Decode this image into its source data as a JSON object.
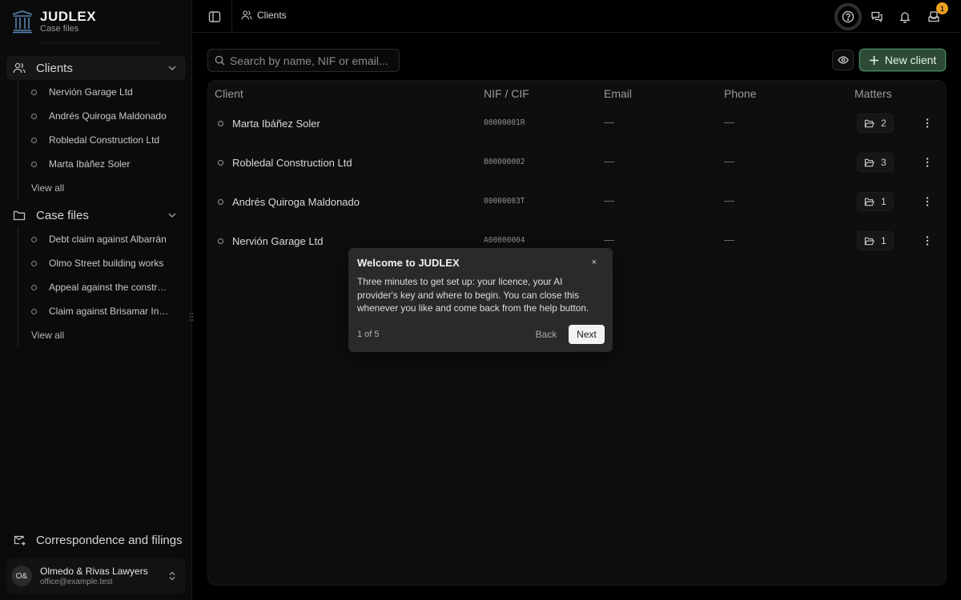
{
  "brand": {
    "name": "JUDLEX",
    "subtitle": "Case files",
    "logo_icon": "columns-logo-icon"
  },
  "sidebar": {
    "clients": {
      "label": "Clients",
      "items": [
        {
          "label": "Nervión Garage Ltd"
        },
        {
          "label": "Andrés Quiroga Maldonado"
        },
        {
          "label": "Robledal Construction Ltd"
        },
        {
          "label": "Marta Ibáñez Soler"
        }
      ],
      "view_all": "View all"
    },
    "case_files": {
      "label": "Case files",
      "items": [
        {
          "label": "Debt claim against Albarrán"
        },
        {
          "label": "Olmo Street building works"
        },
        {
          "label": "Appeal against the construction"
        },
        {
          "label": "Claim against Brisamar Insurance"
        }
      ],
      "view_all": "View all"
    },
    "correspondence": "Correspondence and filings",
    "account": {
      "initials": "O&",
      "name": "Olmedo & Rivas Lawyers",
      "email": "office@example.test"
    }
  },
  "topbar": {
    "breadcrumb": "Clients",
    "notification_count": "1"
  },
  "toolbar": {
    "search_placeholder": "Search by name, NIF or email...",
    "new_client_label": "New client"
  },
  "table": {
    "headers": {
      "client": "Client",
      "nif": "NIF / CIF",
      "email": "Email",
      "phone": "Phone",
      "matters": "Matters"
    },
    "rows": [
      {
        "name": "Marta Ibáñez Soler",
        "nif": "00000001R",
        "email": "—",
        "phone": "—",
        "matters": "2"
      },
      {
        "name": "Robledal Construction Ltd",
        "nif": "B00000002",
        "email": "—",
        "phone": "—",
        "matters": "3"
      },
      {
        "name": "Andrés Quiroga Maldonado",
        "nif": "00000003T",
        "email": "—",
        "phone": "—",
        "matters": "1"
      },
      {
        "name": "Nervión Garage Ltd",
        "nif": "A00000004",
        "email": "—",
        "phone": "—",
        "matters": "1"
      }
    ]
  },
  "tour": {
    "title": "Welcome to JUDLEX",
    "close": "×",
    "body": "Three minutes to get set up: your licence, your AI provider's key and where to begin. You can close this whenever you like and come back from the help button.",
    "step": "1 of 5",
    "back": "Back",
    "next": "Next"
  },
  "colors": {
    "accent_green": "#2d4a37",
    "badge": "#f0a020",
    "background": "#000000"
  }
}
